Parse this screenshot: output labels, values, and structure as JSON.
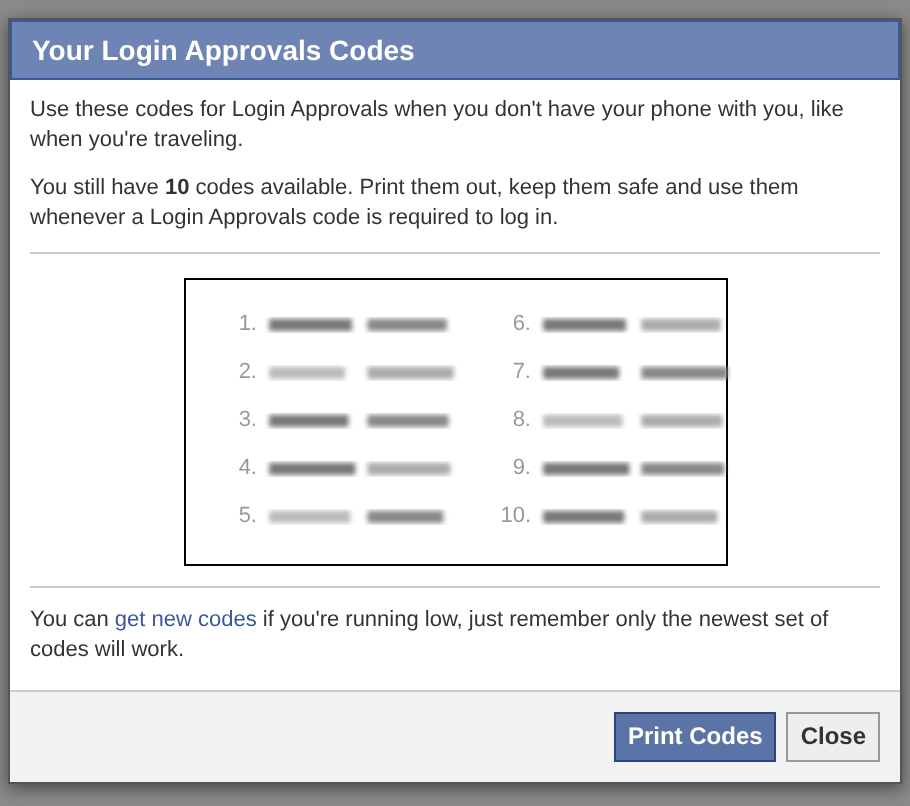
{
  "dialog": {
    "title": "Your Login Approvals Codes",
    "paragraphs": [
      "Use these codes for Login Approvals when you don't have your phone with you, like when you're traveling.",
      "You still have **10** codes available. Print them out, keep them safe and use them whenever a Login Approvals code is required to log in."
    ],
    "codes": [
      {
        "number": "1."
      },
      {
        "number": "2."
      },
      {
        "number": "3."
      },
      {
        "number": "4."
      },
      {
        "number": "5."
      },
      {
        "number": "6."
      },
      {
        "number": "7."
      },
      {
        "number": "8."
      },
      {
        "number": "9."
      },
      {
        "number": "10."
      }
    ],
    "footer_note": {
      "before": "You can",
      "link": "get new codes",
      "after": "if you're running low, just remember only the newest set of codes will work."
    },
    "buttons": [
      {
        "label": "Print Codes",
        "kind": "primary"
      },
      {
        "label": "Close",
        "kind": "secondary"
      }
    ]
  }
}
